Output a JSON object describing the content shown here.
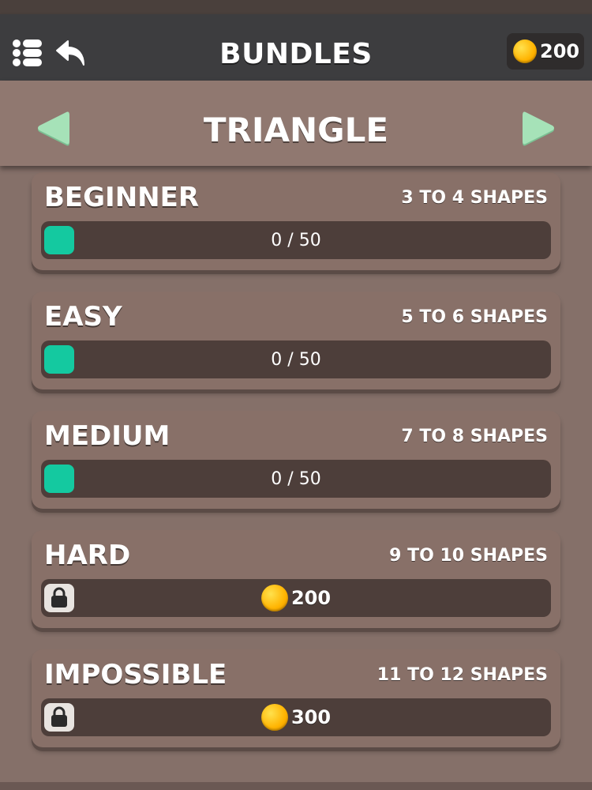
{
  "header": {
    "title": "BUNDLES",
    "coins": "200",
    "menu_icon": "menu-list-icon",
    "back_icon": "back-arrow-icon"
  },
  "category": {
    "title": "TRIANGLE",
    "prev_icon": "triangle-left-icon",
    "next_icon": "triangle-right-icon"
  },
  "bundles": [
    {
      "name": "BEGINNER",
      "shapes": "3 TO 4 SHAPES",
      "locked": false,
      "progress": "0 / 50"
    },
    {
      "name": "EASY",
      "shapes": "5 TO 6 SHAPES",
      "locked": false,
      "progress": "0 / 50"
    },
    {
      "name": "MEDIUM",
      "shapes": "7 TO 8 SHAPES",
      "locked": false,
      "progress": "0 / 50"
    },
    {
      "name": "HARD",
      "shapes": "9 TO 10 SHAPES",
      "locked": true,
      "price": "200"
    },
    {
      "name": "IMPOSSIBLE",
      "shapes": "11 TO 12 SHAPES",
      "locked": true,
      "price": "300"
    }
  ],
  "colors": {
    "background": "#857069",
    "header": "#3d3d3f",
    "progress_fill": "#14c9a0",
    "arrow": "#a6e2b8",
    "coin": "#ffb300"
  }
}
